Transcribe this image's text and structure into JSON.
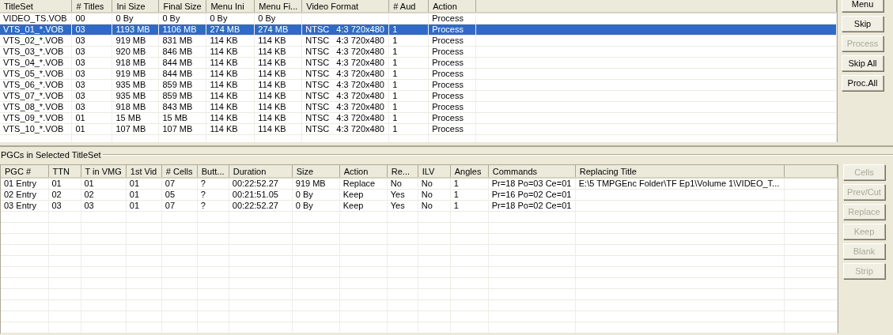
{
  "titlesets": {
    "columns": [
      "TitleSet",
      "# Titles",
      "Ini Size",
      "Final Size",
      "Menu Ini",
      "Menu Fi...",
      "Video Format",
      "# Aud",
      "Action"
    ],
    "rows": [
      {
        "cells": [
          "VIDEO_TS.VOB",
          "00",
          "0 By",
          "0 By",
          "0 By",
          "0 By",
          "",
          "",
          "Process"
        ],
        "selected": false
      },
      {
        "cells": [
          "VTS_01_*.VOB",
          "03",
          "1193 MB",
          "1106 MB",
          "274 MB",
          "274 MB",
          "NTSC   4:3 720x480",
          "1",
          "Process"
        ],
        "selected": true
      },
      {
        "cells": [
          "VTS_02_*.VOB",
          "03",
          "919 MB",
          "831 MB",
          "114 KB",
          "114 KB",
          "NTSC   4:3 720x480",
          "1",
          "Process"
        ],
        "selected": false
      },
      {
        "cells": [
          "VTS_03_*.VOB",
          "03",
          "920 MB",
          "846 MB",
          "114 KB",
          "114 KB",
          "NTSC   4:3 720x480",
          "1",
          "Process"
        ],
        "selected": false
      },
      {
        "cells": [
          "VTS_04_*.VOB",
          "03",
          "918 MB",
          "844 MB",
          "114 KB",
          "114 KB",
          "NTSC   4:3 720x480",
          "1",
          "Process"
        ],
        "selected": false
      },
      {
        "cells": [
          "VTS_05_*.VOB",
          "03",
          "919 MB",
          "844 MB",
          "114 KB",
          "114 KB",
          "NTSC   4:3 720x480",
          "1",
          "Process"
        ],
        "selected": false
      },
      {
        "cells": [
          "VTS_06_*.VOB",
          "03",
          "935 MB",
          "859 MB",
          "114 KB",
          "114 KB",
          "NTSC   4:3 720x480",
          "1",
          "Process"
        ],
        "selected": false
      },
      {
        "cells": [
          "VTS_07_*.VOB",
          "03",
          "935 MB",
          "859 MB",
          "114 KB",
          "114 KB",
          "NTSC   4:3 720x480",
          "1",
          "Process"
        ],
        "selected": false
      },
      {
        "cells": [
          "VTS_08_*.VOB",
          "03",
          "918 MB",
          "843 MB",
          "114 KB",
          "114 KB",
          "NTSC   4:3 720x480",
          "1",
          "Process"
        ],
        "selected": false
      },
      {
        "cells": [
          "VTS_09_*.VOB",
          "01",
          "15 MB",
          "15 MB",
          "114 KB",
          "114 KB",
          "NTSC   4:3 720x480",
          "1",
          "Process"
        ],
        "selected": false
      },
      {
        "cells": [
          "VTS_10_*.VOB",
          "01",
          "107 MB",
          "107 MB",
          "114 KB",
          "114 KB",
          "NTSC   4:3 720x480",
          "1",
          "Process"
        ],
        "selected": false
      }
    ],
    "buttons": [
      {
        "label": "Menu",
        "disabled": false
      },
      {
        "label": "Skip",
        "disabled": false
      },
      {
        "label": "Process",
        "disabled": true
      },
      {
        "label": "Skip All",
        "disabled": false
      },
      {
        "label": "Proc.All",
        "disabled": false
      }
    ]
  },
  "pgcs": {
    "title": "PGCs in Selected TitleSet",
    "columns": [
      "PGC #",
      "TTN",
      "T in VMG",
      "1st Vid",
      "# Cells",
      "Butt...",
      "Duration",
      "Size",
      "Action",
      "Re...",
      "ILV",
      "Angles",
      "Commands",
      "Replacing Title"
    ],
    "rows": [
      {
        "cells": [
          "01 Entry",
          "01",
          "01",
          "01",
          "07",
          "?",
          "00:22:52.27",
          "919 MB",
          "Replace",
          "No",
          "No",
          "1",
          "Pr=18 Po=03 Ce=01",
          "E:\\5 TMPGEnc Folder\\TF Ep1\\Volume 1\\VIDEO_T..."
        ],
        "selected": false
      },
      {
        "cells": [
          "02 Entry",
          "02",
          "02",
          "01",
          "05",
          "?",
          "00:21:51.05",
          "0 By",
          "Keep",
          "Yes",
          "No",
          "1",
          "Pr=16 Po=02 Ce=01",
          ""
        ],
        "selected": false
      },
      {
        "cells": [
          "03 Entry",
          "03",
          "03",
          "01",
          "07",
          "?",
          "00:22:52.27",
          "0 By",
          "Keep",
          "Yes",
          "No",
          "1",
          "Pr=18 Po=02 Ce=01",
          ""
        ],
        "selected": false
      }
    ],
    "buttons": [
      {
        "label": "Cells",
        "disabled": true
      },
      {
        "label": "Prev/Cut",
        "disabled": true
      },
      {
        "label": "Replace",
        "disabled": true
      },
      {
        "label": "Keep",
        "disabled": true
      },
      {
        "label": "Blank",
        "disabled": true
      },
      {
        "label": "Strip",
        "disabled": true
      }
    ]
  }
}
